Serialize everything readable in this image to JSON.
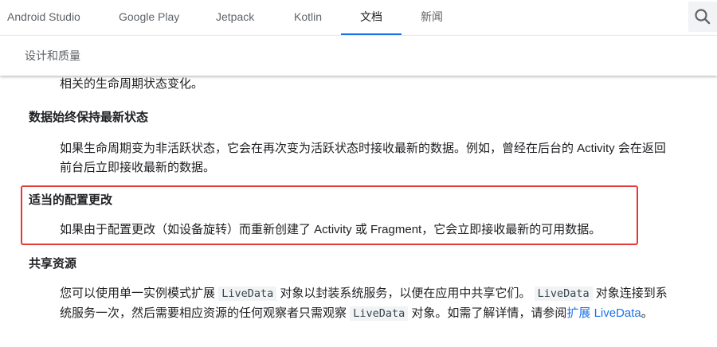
{
  "nav": {
    "tabs": [
      "Android Studio",
      "Google Play",
      "Jetpack",
      "Kotlin",
      "文档",
      "新闻"
    ],
    "active_tab": "文档",
    "accent_color": "#1a73e8"
  },
  "subnav": {
    "label": "设计和质量"
  },
  "content": {
    "prev_text_tail": "相关的生命周期状态变化。",
    "sec1": {
      "heading": "数据始终保持最新状态",
      "line1": "如果生命周期变为非活跃状态，它会在再次变为活跃状态时接收最新的数据。例如，曾经在后台的 Activity 会在返回",
      "line2": "前台后立即接收最新的数据。"
    },
    "sec2": {
      "heading": "适当的配置更改",
      "body": "如果由于配置更改（如设备旋转）而重新创建了 Activity 或 Fragment，它会立即接收最新的可用数据。",
      "highlight_color": "#e53935"
    },
    "sec3": {
      "heading": "共享资源",
      "l1_a": "您可以使用单一实例模式扩展",
      "code1": "LiveData",
      "l1_b": "对象以封装系统服务，以便在应用中共享它们。",
      "code2": "LiveData",
      "l1_c": "对象连接到系",
      "l2_a": "统服务一次，然后需要相应资源的任何观察者只需观察",
      "code3": "LiveData",
      "l2_b": "对象。如需了解详情，请参阅",
      "link_text": "扩展 LiveData",
      "l2_end": "。"
    }
  }
}
